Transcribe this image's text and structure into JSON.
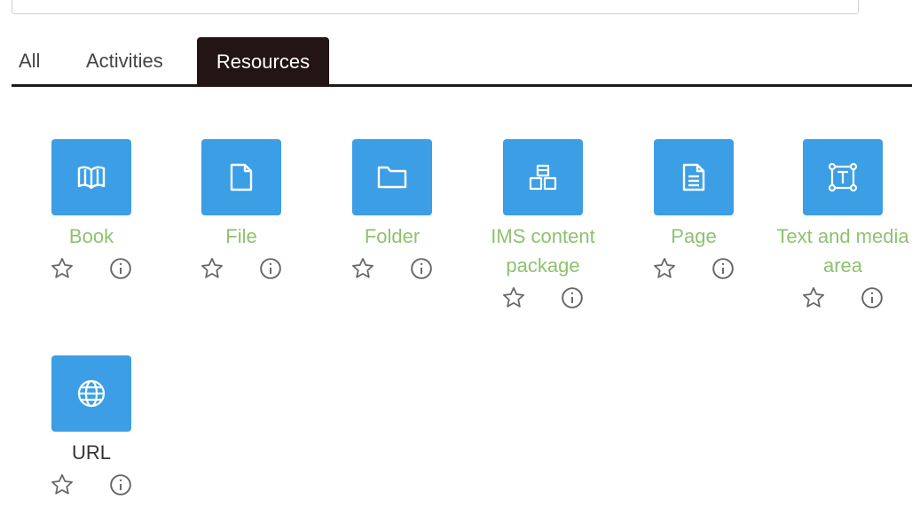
{
  "tabs": [
    {
      "label": "All"
    },
    {
      "label": "Activities"
    },
    {
      "label": "Resources"
    }
  ],
  "active_tab": "Resources",
  "items": [
    {
      "label": "Book",
      "icon": "book-icon"
    },
    {
      "label": "File",
      "icon": "file-icon"
    },
    {
      "label": "Folder",
      "icon": "folder-icon"
    },
    {
      "label": "IMS content package",
      "icon": "package-icon"
    },
    {
      "label": "Page",
      "icon": "page-icon"
    },
    {
      "label": "Text and media area",
      "icon": "text-media-icon"
    },
    {
      "label": "URL",
      "icon": "globe-icon"
    }
  ],
  "colors": {
    "tile": "#3c9ee4",
    "link": "#8dc26f",
    "active_tab_bg": "#231416"
  }
}
